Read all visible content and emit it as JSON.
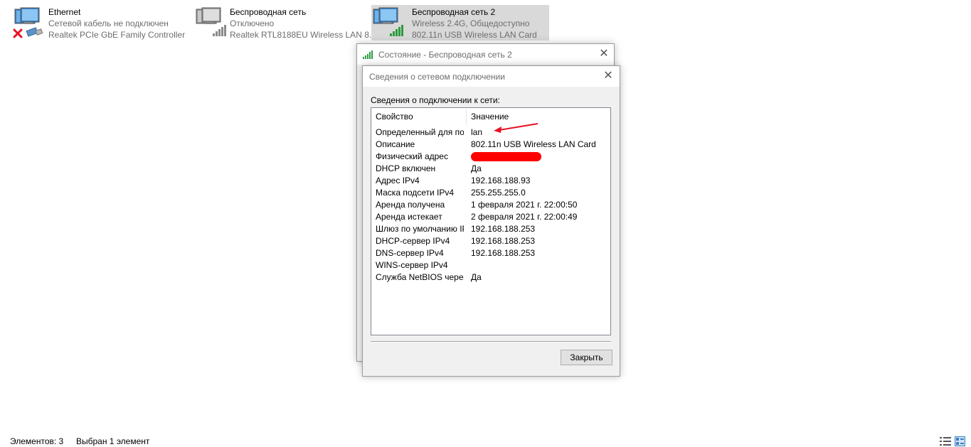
{
  "adapters": [
    {
      "name": "Ethernet",
      "line1": "Сетевой кабель не подключен",
      "line2": "Realtek PCIe GbE Family Controller"
    },
    {
      "name": "Беспроводная сеть",
      "line1": "Отключено",
      "line2": "Realtek RTL8188EU Wireless LAN 8..."
    },
    {
      "name": "Беспроводная сеть 2",
      "line1": "Wireless 2.4G, Общедоступно",
      "line2": "802.11n USB Wireless LAN Card"
    }
  ],
  "status_dialog": {
    "title": "Состояние - Беспроводная сеть 2"
  },
  "details_dialog": {
    "title": "Сведения о сетевом подключении",
    "section_label": "Сведения о подключении к сети:",
    "columns": [
      "Свойство",
      "Значение"
    ],
    "rows": [
      {
        "p": "Определенный для по...",
        "v": "lan"
      },
      {
        "p": "Описание",
        "v": "802.11n USB Wireless LAN Card"
      },
      {
        "p": "Физический адрес",
        "v": ""
      },
      {
        "p": "DHCP включен",
        "v": "Да"
      },
      {
        "p": "Адрес IPv4",
        "v": "192.168.188.93"
      },
      {
        "p": "Маска подсети IPv4",
        "v": "255.255.255.0"
      },
      {
        "p": "Аренда получена",
        "v": "1 февраля 2021 г. 22:00:50"
      },
      {
        "p": "Аренда истекает",
        "v": "2 февраля 2021 г. 22:00:49"
      },
      {
        "p": "Шлюз по умолчанию IP...",
        "v": "192.168.188.253"
      },
      {
        "p": "DHCP-сервер IPv4",
        "v": "192.168.188.253"
      },
      {
        "p": "DNS-сервер IPv4",
        "v": "192.168.188.253"
      },
      {
        "p": "WINS-сервер IPv4",
        "v": ""
      },
      {
        "p": "Служба NetBIOS через...",
        "v": "Да"
      }
    ],
    "close_button": "Закрыть"
  },
  "statusbar": {
    "items_count": "Элементов: 3",
    "selected": "Выбран 1 элемент"
  },
  "colors": {
    "redaction": "#ff0000",
    "arrow": "#e81123",
    "signal_green": "#2e9c3f"
  },
  "icons": [
    "network-adapter-icon",
    "disconnected-x-icon",
    "cable-plug-icon",
    "signal-bars-icon",
    "close-icon",
    "details-view-icon",
    "tiles-view-icon"
  ]
}
